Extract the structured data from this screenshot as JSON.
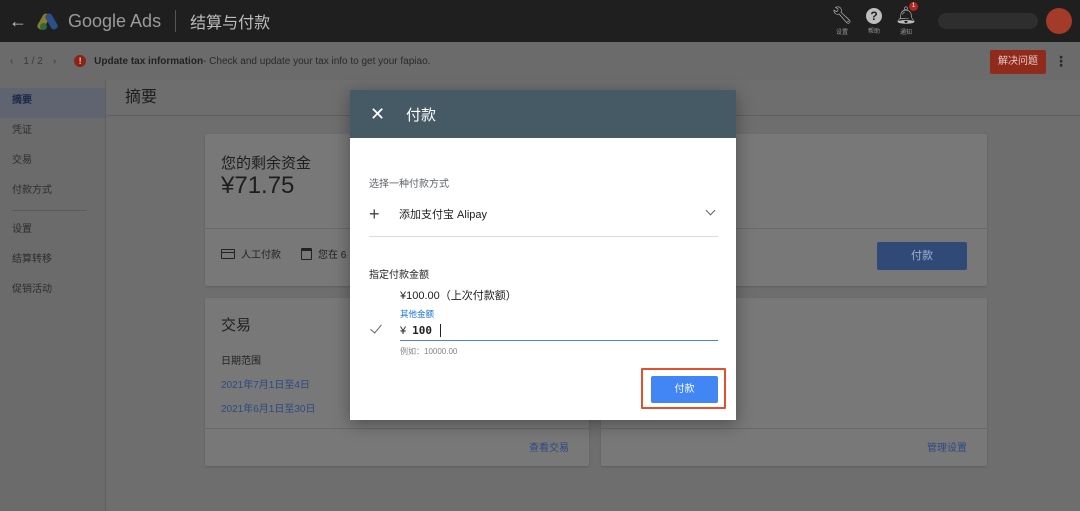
{
  "topbar": {
    "product_name": "Google Ads",
    "page_title": "结算与付款",
    "tools": [
      {
        "icon": "wrench-icon",
        "label": "设置"
      },
      {
        "icon": "help-icon",
        "label": "帮助"
      },
      {
        "icon": "bell-icon",
        "label": "通知"
      }
    ],
    "notification_count": "1"
  },
  "notice": {
    "pager": "1 / 2",
    "title": "Update tax information",
    "message": " - Check and update your tax info to get your fapiao.",
    "resolve_label": "解决问题"
  },
  "sidebar": {
    "items": [
      {
        "label": "摘要",
        "active": true
      },
      {
        "label": "凭证"
      },
      {
        "label": "交易"
      },
      {
        "label": "付款方式"
      },
      {
        "label": "设置"
      },
      {
        "label": "结算转移"
      },
      {
        "label": "促销活动"
      }
    ]
  },
  "main": {
    "header": "摘要",
    "balance_card": {
      "title": "您的剩余资金",
      "amount": "¥71.75",
      "manual_pay": "人工付款",
      "schedule_text": "您在 6",
      "pay_label": "付款"
    },
    "transactions_card": {
      "title": "交易",
      "range_label": "日期范围",
      "ranges": [
        "2021年7月1日至4日",
        "2021年6月1日至30日"
      ],
      "view_link": "查看交易"
    },
    "settings_card": {
      "manage_link": "管理设置"
    }
  },
  "modal": {
    "title": "付款",
    "payment_method_label": "选择一种付款方式",
    "add_alipay": "添加支付宝 Alipay",
    "amount_label": "指定付款金额",
    "last_amount": "¥100.00（上次付款额）",
    "other_amount_label": "其他金额",
    "currency_symbol": "¥",
    "amount_value": "100",
    "amount_hint": "例如：10000.00",
    "pay_button": "付款"
  },
  "colors": {
    "modal_header": "#455a64",
    "primary_button": "#4285f4",
    "highlight_box": "#e3512c",
    "link": "#1a73e8"
  }
}
